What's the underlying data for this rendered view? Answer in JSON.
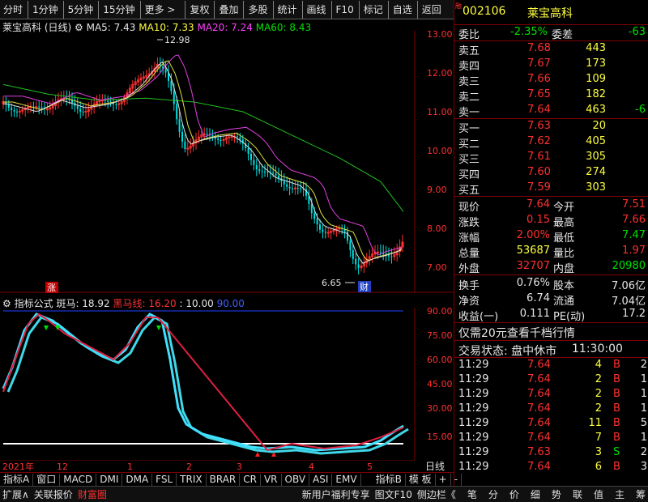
{
  "toolbar": {
    "items": [
      "分时",
      "1分钟",
      "5分钟",
      "15分钟",
      "更多 >",
      "复权",
      "叠加",
      "多股",
      "统计",
      "画线",
      "F10",
      "标记",
      "自选",
      "返回"
    ]
  },
  "main_chart": {
    "title": "莱宝高科 (日线)",
    "ma5": "MA5: 7.43",
    "ma10": "MA10: 7.33",
    "ma20": "MA20: 7.24",
    "ma60": "MA60: 8.43",
    "high_label": "12.98",
    "low_label": "6.65",
    "badge_zhang": "涨",
    "badge_cai": "财",
    "y_ticks": [
      "13.00",
      "12.00",
      "11.00",
      "10.00",
      "9.00",
      "8.00",
      "7.00"
    ]
  },
  "indicator": {
    "name": "指标公式",
    "zebra": "斑马: 18.92",
    "black_horse": "黑马线: 16.20",
    "v10": ": 10.00",
    "v90": "90.00",
    "y_ticks": [
      "90.00",
      "75.00",
      "60.00",
      "45.00",
      "30.00",
      "15.00"
    ]
  },
  "x_axis": {
    "labels": [
      "2021年",
      "12",
      "1",
      "2",
      "3",
      "4",
      "5"
    ],
    "period": "日线"
  },
  "bottom_tabs": [
    "指标A",
    "窗口",
    "MACD",
    "DMI",
    "DMA",
    "FSL",
    "TRIX",
    "BRAR",
    "CR",
    "VR",
    "OBV",
    "ASI",
    "EMV",
    "指标B",
    "模 板",
    "+",
    "-"
  ],
  "status_left": [
    "扩展∧",
    "关联报价",
    "财富圈"
  ],
  "status_right": [
    "新用户福利专享",
    "图文F10",
    "侧边栏《",
    "笔",
    "分",
    "价",
    "细",
    "势",
    "联",
    "值",
    "主",
    "筹"
  ],
  "quote": {
    "code": "002106",
    "name": "莱宝高科",
    "flag": "融",
    "webi_label": "委比",
    "webi": "-2.35%",
    "weicha_label": "委差",
    "weicha": "-63",
    "asks": [
      {
        "label": "卖五",
        "price": "7.68",
        "vol": "443"
      },
      {
        "label": "卖四",
        "price": "7.67",
        "vol": "173"
      },
      {
        "label": "卖三",
        "price": "7.66",
        "vol": "109"
      },
      {
        "label": "卖二",
        "price": "7.65",
        "vol": "182"
      },
      {
        "label": "卖一",
        "price": "7.64",
        "vol": "463",
        "chg": "-6"
      }
    ],
    "bids": [
      {
        "label": "买一",
        "price": "7.63",
        "vol": "20"
      },
      {
        "label": "买二",
        "price": "7.62",
        "vol": "405"
      },
      {
        "label": "买三",
        "price": "7.61",
        "vol": "305"
      },
      {
        "label": "买四",
        "price": "7.60",
        "vol": "274"
      },
      {
        "label": "买五",
        "price": "7.59",
        "vol": "303"
      }
    ],
    "stats": [
      {
        "l1": "现价",
        "v1": "7.64",
        "l2": "今开",
        "v2": "7.51"
      },
      {
        "l1": "涨跌",
        "v1": "0.15",
        "l2": "最高",
        "v2": "7.66"
      },
      {
        "l1": "涨幅",
        "v1": "2.00%",
        "l2": "最低",
        "v2": "7.47"
      },
      {
        "l1": "总量",
        "v1": "53687",
        "l2": "量比",
        "v2": "1.97"
      },
      {
        "l1": "外盘",
        "v1": "32707",
        "l2": "内盘",
        "v2": "20980"
      }
    ],
    "stats2": [
      {
        "l1": "换手",
        "v1": "0.76%",
        "l2": "股本",
        "v2": "7.06亿"
      },
      {
        "l1": "净资",
        "v1": "6.74",
        "l2": "流通",
        "v2": "7.04亿"
      },
      {
        "l1": "收益(一)",
        "v1": "0.111",
        "l2": "PE(动)",
        "v2": "17.2"
      }
    ],
    "promo": "仅需20元查看千档行情",
    "trade_status_label": "交易状态: 盘中休市",
    "trade_status_time": "11:30:00",
    "ticks": [
      {
        "t": "11:29",
        "p": "7.64",
        "v": "4",
        "s": "B",
        "n": "2"
      },
      {
        "t": "11:29",
        "p": "7.64",
        "v": "2",
        "s": "B",
        "n": "1"
      },
      {
        "t": "11:29",
        "p": "7.64",
        "v": "2",
        "s": "B",
        "n": "1"
      },
      {
        "t": "11:29",
        "p": "7.64",
        "v": "2",
        "s": "B",
        "n": "1"
      },
      {
        "t": "11:29",
        "p": "7.64",
        "v": "11",
        "s": "B",
        "n": "5"
      },
      {
        "t": "11:29",
        "p": "7.64",
        "v": "7",
        "s": "B",
        "n": "1"
      },
      {
        "t": "11:29",
        "p": "7.63",
        "v": "3",
        "s": "S",
        "n": "2"
      },
      {
        "t": "11:29",
        "p": "7.64",
        "v": "6",
        "s": "B",
        "n": "3"
      }
    ]
  }
}
